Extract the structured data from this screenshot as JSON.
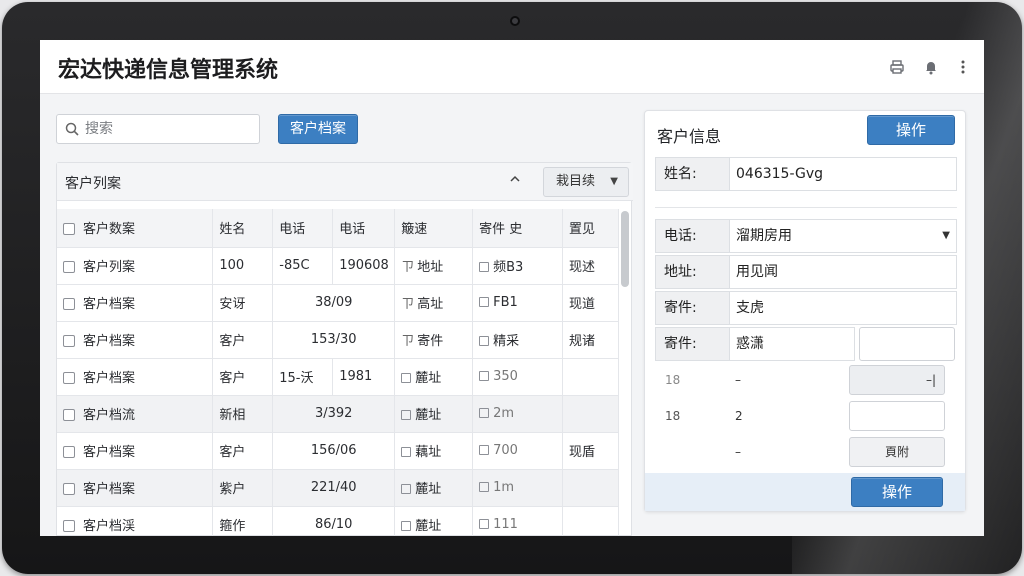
{
  "app": {
    "title": "宏达快递信息管理系统"
  },
  "header_icons": [
    "printer-icon",
    "bell-icon",
    "more-vertical-icon"
  ],
  "search": {
    "placeholder": "搜索",
    "value": ""
  },
  "toolbar": {
    "archive_label": "客户档案"
  },
  "list": {
    "title": "客户列案",
    "column_select_label": "栽目续",
    "columns": [
      "客户数案",
      "姓名",
      "电话",
      "电话",
      "簸速",
      "寄件 史",
      "置见"
    ],
    "rows": [
      {
        "name": "客户列案",
        "c1": "100",
        "c2": "-85C",
        "c3": "190608",
        "c4": "地址",
        "c5": "频B3",
        "c6": "现述"
      },
      {
        "name": "客户档案",
        "c1": "安讶",
        "c2": "38/09",
        "c3": "",
        "c4": "高址",
        "c5": "FB1",
        "c6": "现道"
      },
      {
        "name": "客户档案",
        "c1": "客户",
        "c2": "153/30",
        "c3": "",
        "c4": "寄件",
        "c5": "精采",
        "c6": "规诸"
      },
      {
        "name": "客户档案",
        "c1": "客户",
        "c2": "15-沃",
        "c3": "1981",
        "c4": "麓址",
        "c5": "350",
        "c6": ""
      },
      {
        "name": "客户档流",
        "c1": "新相",
        "c2": "3/392",
        "c3": "",
        "c4": "麓址",
        "c5": "2m",
        "c6": ""
      },
      {
        "name": "客户档案",
        "c1": "客户",
        "c2": "156/06",
        "c3": "",
        "c4": "藕址",
        "c5": "700",
        "c6": "现盾"
      },
      {
        "name": "客户档案",
        "c1": "紫户",
        "c2": "221/40",
        "c3": "",
        "c4": "麓址",
        "c5": "1m",
        "c6": ""
      },
      {
        "name": "客户档渓",
        "c1": "箍作",
        "c2": "86/10",
        "c3": "",
        "c4": "麓址",
        "c5": "111",
        "c6": ""
      }
    ]
  },
  "detail": {
    "title": "客户信息",
    "action_top": "操作",
    "name_label": "姓名:",
    "name_value": "046315-Gvg",
    "phone_label": "电话:",
    "phone_value": "溜期房用",
    "address_label": "地址:",
    "address_value": "用见闻",
    "parcel_label": "寄件:",
    "parcel_value": "支虎",
    "parcel2_label": "寄件:",
    "parcel2_value": "惑潇",
    "small_rows": [
      {
        "left": "18",
        "mid": "–",
        "box": "–|"
      },
      {
        "left": "18",
        "mid": "2",
        "box": ""
      },
      {
        "left": "",
        "mid": "–",
        "box": "頁附"
      }
    ],
    "action_bottom": "操作"
  }
}
